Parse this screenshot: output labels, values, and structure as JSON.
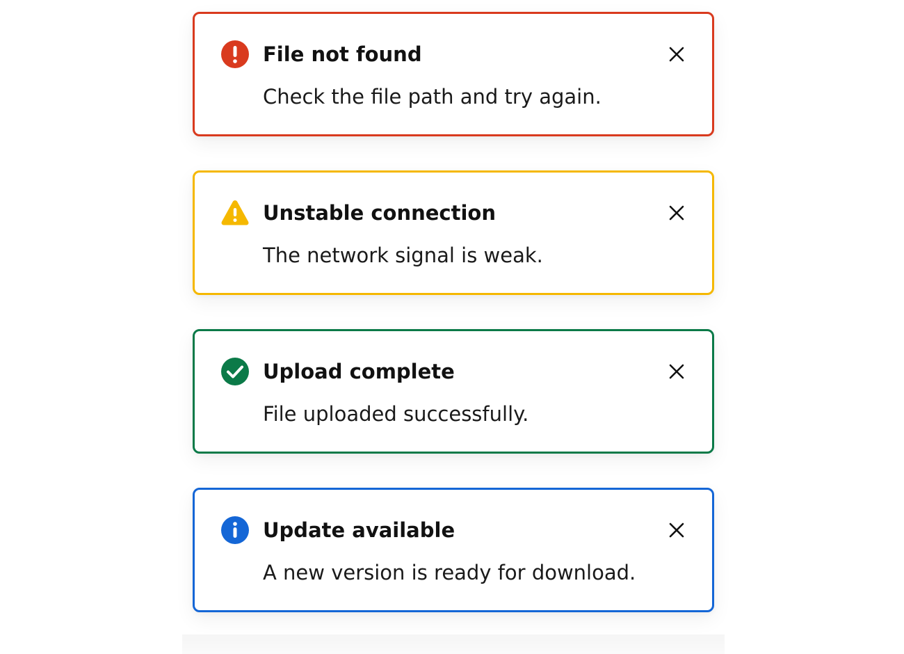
{
  "notifications": [
    {
      "kind": "error",
      "icon": "error-circle-icon",
      "color": "#D93A1E",
      "title": "File not found",
      "message": "Check the file path and try again.",
      "close_icon": "close-icon"
    },
    {
      "kind": "warning",
      "icon": "warning-triangle-icon",
      "color": "#F5B800",
      "title": "Unstable connection",
      "message": "The network signal is weak.",
      "close_icon": "close-icon"
    },
    {
      "kind": "success",
      "icon": "check-circle-icon",
      "color": "#0B7A48",
      "title": "Upload complete",
      "message": "File uploaded successfully.",
      "close_icon": "close-icon"
    },
    {
      "kind": "info",
      "icon": "info-circle-icon",
      "color": "#1466D6",
      "title": "Update available",
      "message": "A new version is ready for download.",
      "close_icon": "close-icon"
    }
  ]
}
